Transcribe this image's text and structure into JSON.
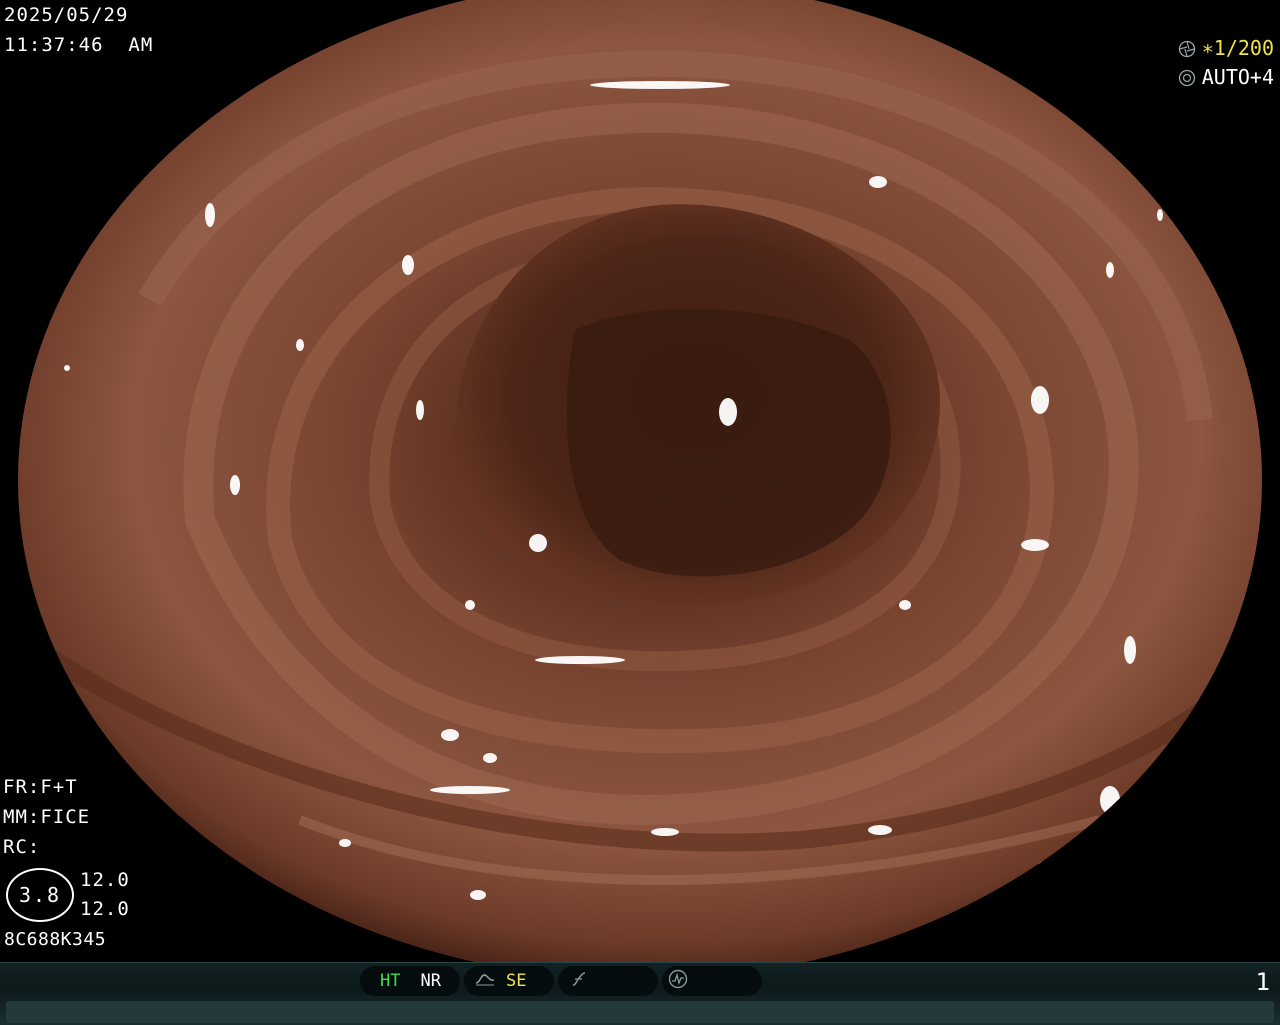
{
  "datetime": {
    "date": "2025/05/29",
    "time": "11:37:46  AM"
  },
  "settings": {
    "shutter_value": "∗1/200",
    "iris_value": "AUTO+4",
    "fr": "FR:F+T",
    "mm": "MM:FICE",
    "rc": "RC:",
    "zoom_value": "3.8",
    "zoom_top": "12.0",
    "zoom_bottom": "12.0",
    "serial": "8C688K345"
  },
  "status_bar": {
    "ht_label": "HT",
    "nr_label": "NR",
    "se_label": "SE",
    "page_number": "1"
  },
  "colors": {
    "tissue": "#6a3c2a",
    "shutter_accent": "#f0e24a",
    "ht_green": "#37e04a",
    "status_bar": "#122224"
  },
  "icons": {
    "shutter": "shutter-icon",
    "iris": "iris-icon",
    "tone_curve": "tone-curve-icon",
    "function": "function-icon",
    "waveform": "waveform-icon"
  }
}
